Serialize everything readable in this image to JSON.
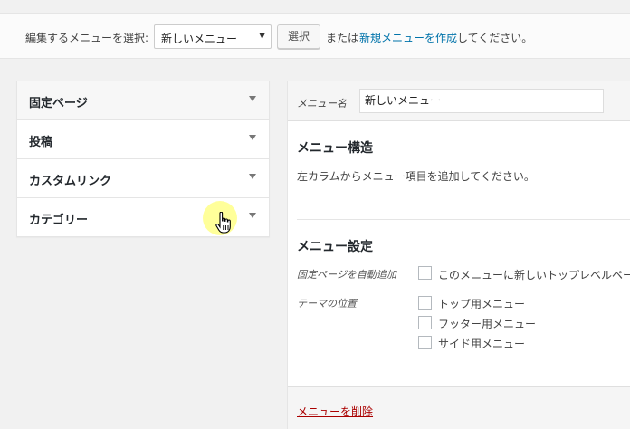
{
  "topbar": {
    "select_label": "編集するメニューを選択:",
    "select_value": "新しいメニュー",
    "select_button": "選択",
    "or_text": "または",
    "create_link": "新規メニューを作成",
    "suffix_text": "してください。"
  },
  "accordion": {
    "items": [
      {
        "label": "固定ページ"
      },
      {
        "label": "投稿"
      },
      {
        "label": "カスタムリンク"
      },
      {
        "label": "カテゴリー"
      }
    ]
  },
  "menu": {
    "name_label": "メニュー名",
    "name_value": "新しいメニュー",
    "structure_title": "メニュー構造",
    "structure_desc": "左カラムからメニュー項目を追加してください。",
    "settings_title": "メニュー設定",
    "auto_add_label": "固定ページを自動追加",
    "auto_add_text": "このメニューに新しいトップレベルページ",
    "location_label": "テーマの位置",
    "locations": [
      {
        "label": "トップ用メニュー"
      },
      {
        "label": "フッター用メニュー"
      },
      {
        "label": "サイド用メニュー"
      }
    ],
    "delete_link": "メニューを削除"
  },
  "colors": {
    "link": "#0073aa",
    "delete": "#aa0000",
    "cursor_highlight": "#ffff78"
  },
  "icons": {
    "accordion_toggle": "triangle-down-icon",
    "select_arrow": "chevron-down-icon",
    "cursor": "hand-pointer-icon"
  }
}
